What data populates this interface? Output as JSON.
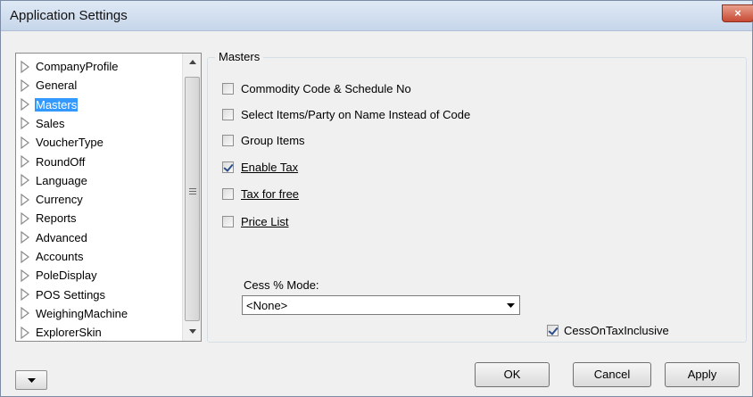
{
  "window": {
    "title": "Application Settings",
    "close_glyph": "×"
  },
  "tree": {
    "items": [
      {
        "label": "CompanyProfile",
        "selected": false
      },
      {
        "label": "General",
        "selected": false
      },
      {
        "label": "Masters",
        "selected": true
      },
      {
        "label": "Sales",
        "selected": false
      },
      {
        "label": "VoucherType",
        "selected": false
      },
      {
        "label": "RoundOff",
        "selected": false
      },
      {
        "label": "Language",
        "selected": false
      },
      {
        "label": "Currency",
        "selected": false
      },
      {
        "label": "Reports",
        "selected": false
      },
      {
        "label": "Advanced",
        "selected": false
      },
      {
        "label": "Accounts",
        "selected": false
      },
      {
        "label": "PoleDisplay",
        "selected": false
      },
      {
        "label": "POS Settings",
        "selected": false
      },
      {
        "label": "WeighingMachine",
        "selected": false
      },
      {
        "label": "ExplorerSkin",
        "selected": false
      }
    ],
    "expand_icon": "triangle-right-outline-icon"
  },
  "masters": {
    "group_title": "Masters",
    "options": [
      {
        "label": "Commodity Code & Schedule No",
        "checked": false,
        "underline": false
      },
      {
        "label": "Select Items/Party on Name Instead of Code",
        "checked": false,
        "underline": false
      },
      {
        "label": "Group Items",
        "checked": false,
        "underline": false
      },
      {
        "label": "Enable Tax",
        "checked": true,
        "underline": true
      },
      {
        "label": "Tax for free",
        "checked": false,
        "underline": true
      },
      {
        "label": "Price List",
        "checked": false,
        "underline": true
      }
    ],
    "cess_mode_label": "Cess % Mode:",
    "cess_mode_value": "<None>",
    "cess_on_tax_inclusive": {
      "label": "CessOnTaxInclusive",
      "checked": true
    }
  },
  "buttons": {
    "ok": "OK",
    "cancel": "Cancel",
    "apply": "Apply"
  },
  "colors": {
    "selection": "#3399ff",
    "close_button": "#c74a34",
    "checkmark": "#2b4e8a"
  }
}
